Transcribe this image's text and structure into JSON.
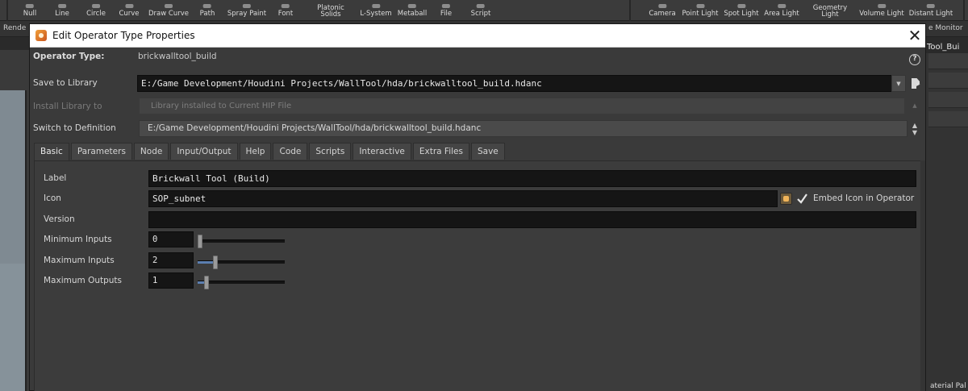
{
  "shelf": {
    "tools": [
      {
        "label": "Null",
        "icon": "null-icon"
      },
      {
        "label": "Line",
        "icon": "line-icon"
      },
      {
        "label": "Circle",
        "icon": "circle-icon"
      },
      {
        "label": "Curve",
        "icon": "curve-icon"
      },
      {
        "label": "Draw Curve",
        "icon": "draw-curve-icon"
      },
      {
        "label": "Path",
        "icon": "path-icon"
      },
      {
        "label": "Spray Paint",
        "icon": "spray-paint-icon"
      },
      {
        "label": "Font",
        "icon": "font-icon"
      },
      {
        "label": "Platonic",
        "label2": "Solids",
        "icon": "platonic-solids-icon"
      },
      {
        "label": "L-System",
        "icon": "l-system-icon"
      },
      {
        "label": "Metaball",
        "icon": "metaball-icon"
      },
      {
        "label": "File",
        "icon": "file-icon"
      },
      {
        "label": "Script",
        "icon": "script-icon"
      },
      {
        "label": "Camera",
        "icon": "camera-icon"
      },
      {
        "label": "Point Light",
        "icon": "point-light-icon"
      },
      {
        "label": "Spot Light",
        "icon": "spot-light-icon"
      },
      {
        "label": "Area Light",
        "icon": "area-light-icon"
      },
      {
        "label": "Geometry",
        "label2": "Light",
        "icon": "geometry-light-icon"
      },
      {
        "label": "Volume Light",
        "icon": "volume-light-icon"
      },
      {
        "label": "Distant Light",
        "icon": "distant-light-icon"
      }
    ],
    "row2_left": "Rende",
    "row2_right": "e Monitor",
    "pane_tab_right": "Tool_Bui",
    "side_right_bottom": "aterial Pal"
  },
  "dialog": {
    "title": "Edit Operator Type Properties",
    "operator_type_label": "Operator Type:",
    "operator_type_value": "brickwalltool_build",
    "save_to_library_label": "Save to Library",
    "save_to_library_value": "E:/Game Development/Houdini Projects/WallTool/hda/brickwalltool_build.hdanc",
    "install_library_label": "Install Library to",
    "install_library_value": "Library installed to Current HIP File",
    "switch_definition_label": "Switch to Definition",
    "switch_definition_value": "E:/Game Development/Houdini Projects/WallTool/hda/brickwalltool_build.hdanc",
    "tabs": [
      "Basic",
      "Parameters",
      "Node",
      "Input/Output",
      "Help",
      "Code",
      "Scripts",
      "Interactive",
      "Extra Files",
      "Save"
    ],
    "active_tab": "Basic",
    "basic": {
      "label_label": "Label",
      "label_value": "Brickwall Tool (Build)",
      "icon_label": "Icon",
      "icon_value": "SOP_subnet",
      "embed_icon_label": "Embed Icon in Operator",
      "embed_icon_checked": true,
      "version_label": "Version",
      "version_value": "",
      "min_inputs_label": "Minimum Inputs",
      "min_inputs_value": "0",
      "min_inputs_fraction": 0.0,
      "max_inputs_label": "Maximum Inputs",
      "max_inputs_value": "2",
      "max_inputs_fraction": 0.2,
      "max_outputs_label": "Maximum Outputs",
      "max_outputs_value": "1",
      "max_outputs_fraction": 0.1
    }
  },
  "colors": {
    "panel_bg": "#3a3a3a",
    "field_bg": "#151515",
    "slider_fill": "#5c7fb0",
    "title_bar": "#ffffff"
  }
}
